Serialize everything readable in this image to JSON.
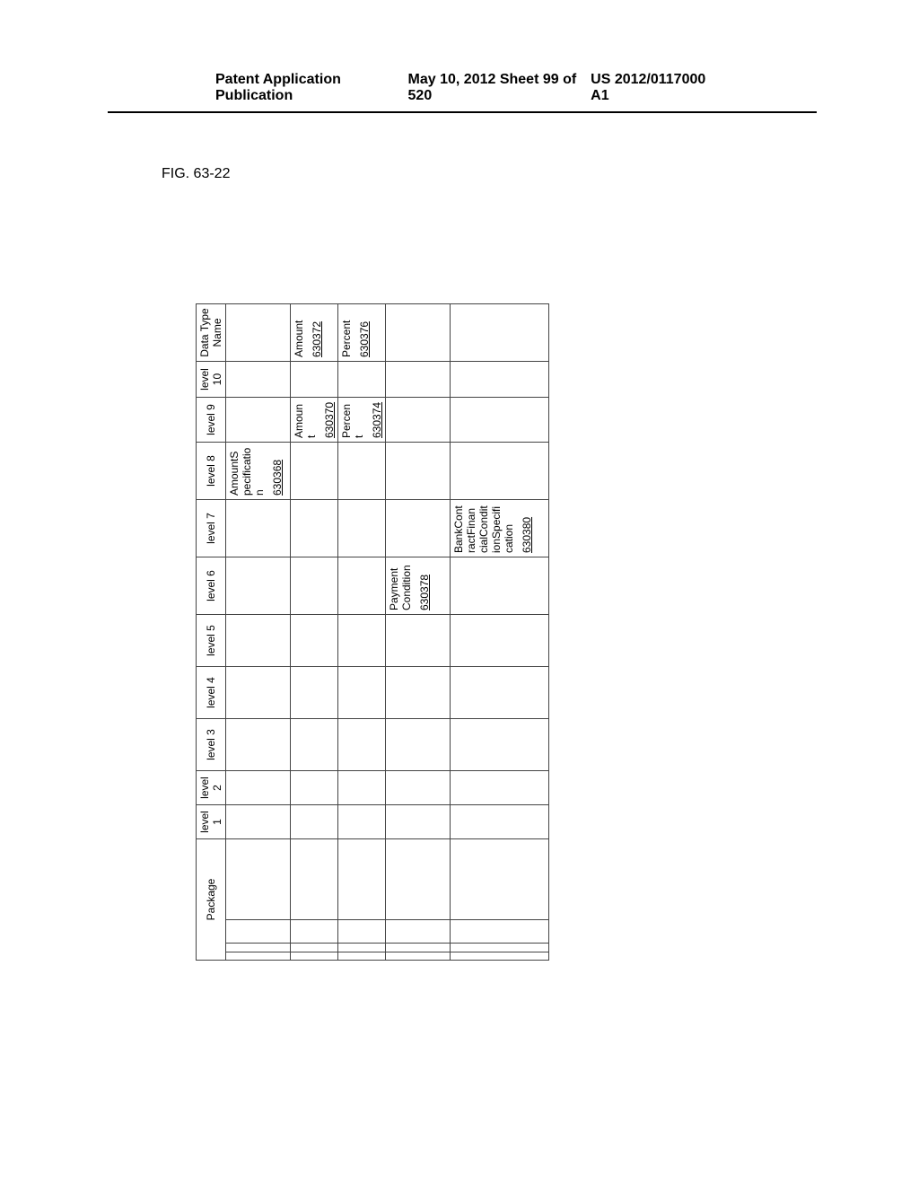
{
  "header": {
    "left": "Patent Application Publication",
    "center": "May 10, 2012  Sheet 99 of 520",
    "right": "US 2012/0117000 A1"
  },
  "figure_label": "FIG. 63-22",
  "columns": {
    "package": "Package",
    "l1": "level 1",
    "l2": "level 2",
    "l3": "level 3",
    "l4": "level 4",
    "l5": "level 5",
    "l6": "level 6",
    "l7": "level 7",
    "l8": "level 8",
    "l9": "level 9",
    "l10": "level 10",
    "dtn": "Data Type Name"
  },
  "rows": [
    {
      "l8": {
        "text": "AmountSpecification",
        "ref": "630368"
      }
    },
    {
      "l9": {
        "text": "Amount",
        "ref": "630370"
      },
      "dtn": {
        "text": "Amount",
        "ref": "630372"
      }
    },
    {
      "l9": {
        "text": "Percent",
        "ref": "630374"
      },
      "dtn": {
        "text": "Percent",
        "ref": "630376"
      }
    },
    {
      "l6": {
        "text": "PaymentCondition",
        "ref": "630378"
      }
    },
    {
      "l7": {
        "text": "BankContractFinancialConditionSpecification",
        "ref": "630380"
      }
    }
  ]
}
